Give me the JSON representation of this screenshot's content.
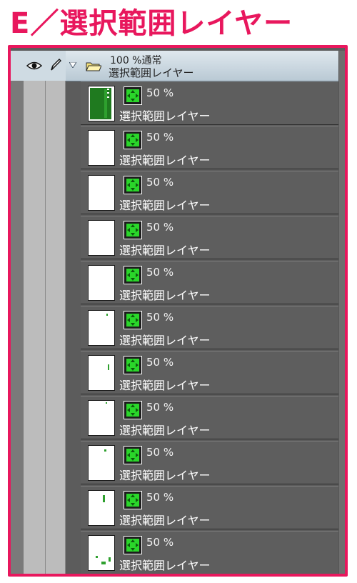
{
  "page_title": "E／選択範囲レイヤー",
  "folder": {
    "opacity_mode": "100 %通常",
    "name": "選択範囲レイヤー"
  },
  "colors": {
    "frame": "#e8175d",
    "selection_green": "#2ad62a",
    "panel_bg": "#5c5c5c"
  },
  "layers": [
    {
      "opacity": "50 %",
      "name": "選択範囲レイヤー"
    },
    {
      "opacity": "50 %",
      "name": "選択範囲レイヤー"
    },
    {
      "opacity": "50 %",
      "name": "選択範囲レイヤー"
    },
    {
      "opacity": "50 %",
      "name": "選択範囲レイヤー"
    },
    {
      "opacity": "50 %",
      "name": "選択範囲レイヤー"
    },
    {
      "opacity": "50 %",
      "name": "選択範囲レイヤー"
    },
    {
      "opacity": "50 %",
      "name": "選択範囲レイヤー"
    },
    {
      "opacity": "50 %",
      "name": "選択範囲レイヤー"
    },
    {
      "opacity": "50 %",
      "name": "選択範囲レイヤー"
    },
    {
      "opacity": "50 %",
      "name": "選択範囲レイヤー"
    },
    {
      "opacity": "50 %",
      "name": "選択範囲レイヤー"
    }
  ]
}
